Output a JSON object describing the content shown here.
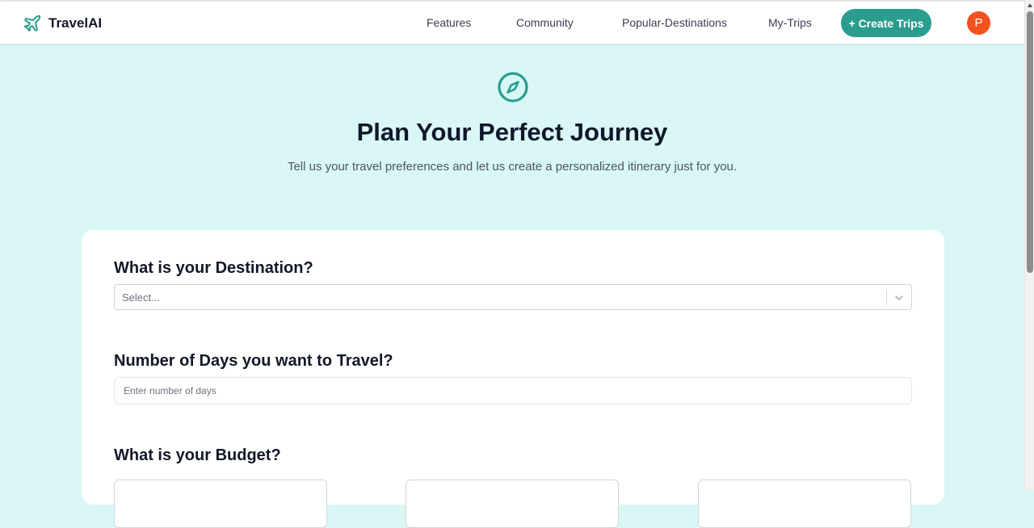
{
  "header": {
    "brand_name": "TravelAI",
    "nav": [
      {
        "label": "Features"
      },
      {
        "label": "Community"
      },
      {
        "label": "Popular-Destinations"
      },
      {
        "label": "My-Trips"
      }
    ],
    "cta_label": "+ Create Trips",
    "avatar_initial": "P"
  },
  "hero": {
    "title": "Plan Your Perfect Journey",
    "subtitle": "Tell us your travel preferences and let us create a personalized itinerary just for you."
  },
  "form": {
    "destination": {
      "label": "What is your Destination?",
      "placeholder": "Select..."
    },
    "days": {
      "label": "Number of Days you want to Travel?",
      "placeholder": "Enter number of days",
      "value": ""
    },
    "budget": {
      "label": "What is your Budget?"
    }
  },
  "colors": {
    "accent": "#2a9d8f",
    "page_background": "#d9f7f5",
    "avatar": "#f4511e"
  }
}
